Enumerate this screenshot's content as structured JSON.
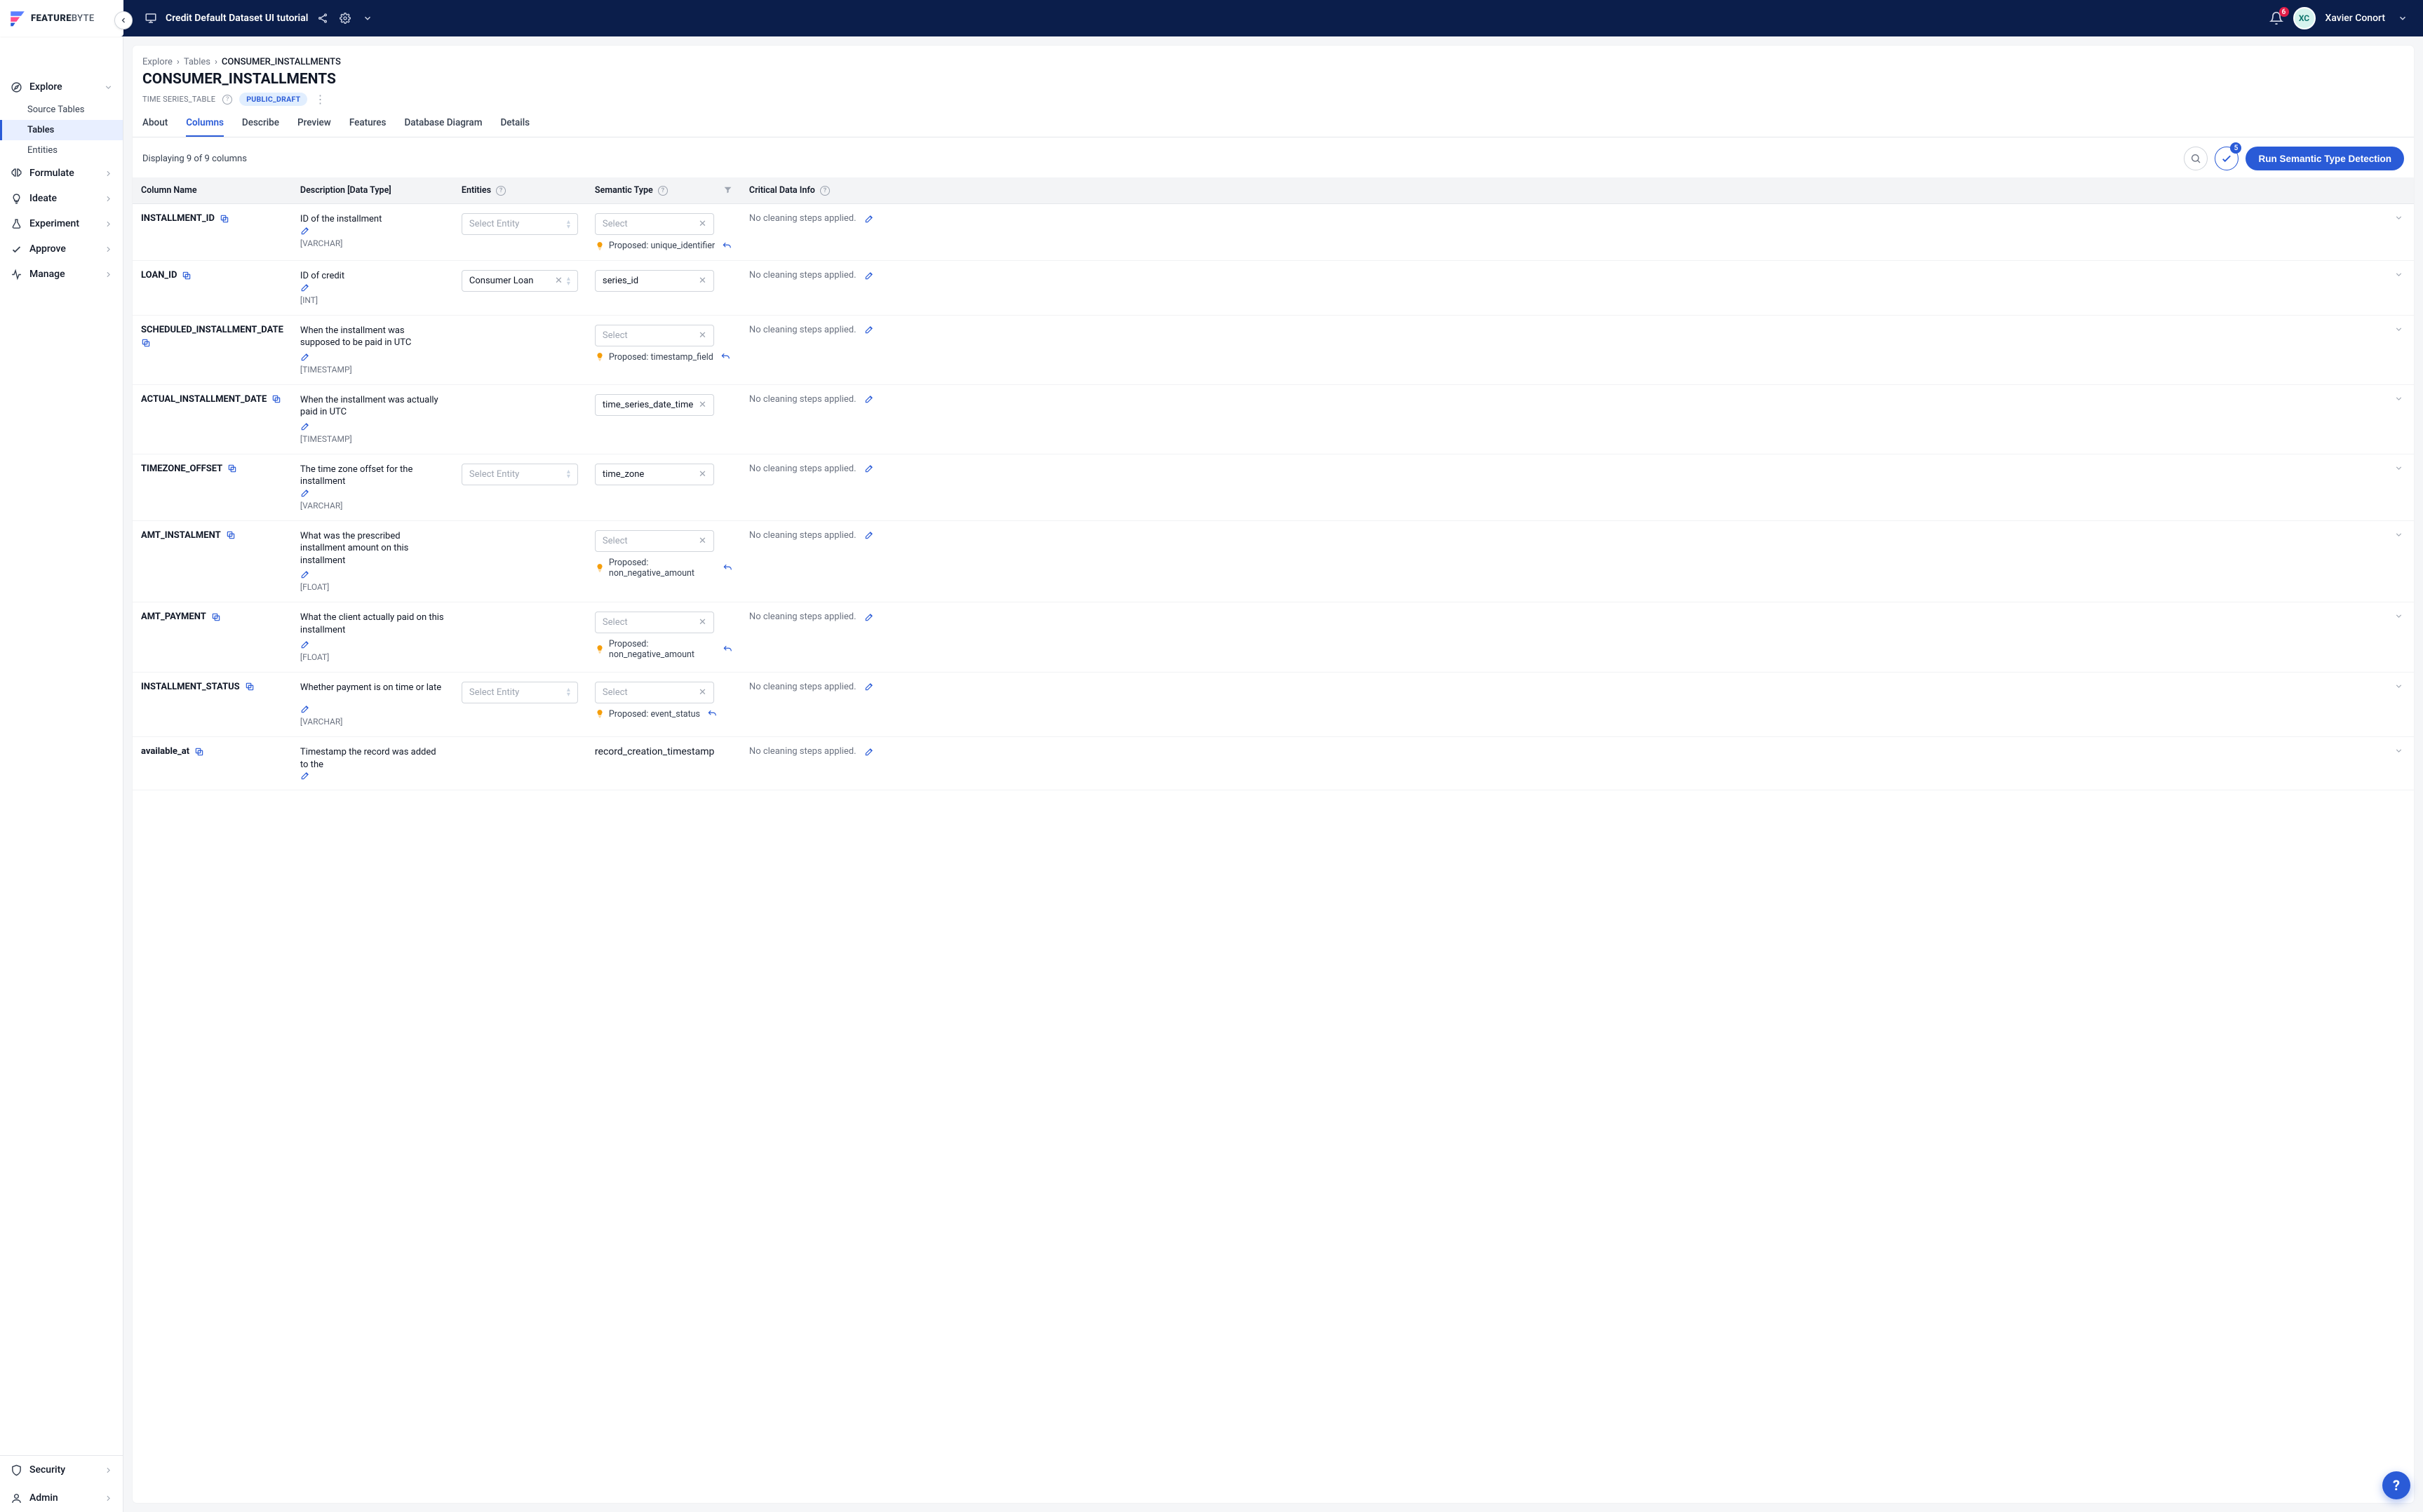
{
  "brand": {
    "name1": "FEATURE",
    "name2": "BYTE"
  },
  "header": {
    "project": "Credit Default Dataset UI tutorial",
    "notification_count": "6",
    "user_initials": "XC",
    "user_name": "Xavier Conort"
  },
  "sidebar": {
    "top": [
      {
        "label": "Explore",
        "icon": "compass",
        "expanded": true
      },
      {
        "label": "Source Tables",
        "sub": true
      },
      {
        "label": "Tables",
        "sub": true,
        "active": true
      },
      {
        "label": "Entities",
        "sub": true
      },
      {
        "label": "Formulate",
        "icon": "brain"
      },
      {
        "label": "Ideate",
        "icon": "bulb"
      },
      {
        "label": "Experiment",
        "icon": "flask"
      },
      {
        "label": "Approve",
        "icon": "check"
      },
      {
        "label": "Manage",
        "icon": "activity"
      }
    ],
    "bottom": [
      {
        "label": "Security",
        "icon": "shield"
      },
      {
        "label": "Admin",
        "icon": "user"
      }
    ]
  },
  "breadcrumb": {
    "root": "Explore",
    "mid": "Tables",
    "current": "CONSUMER_INSTALLMENTS"
  },
  "page": {
    "title": "CONSUMER_INSTALLMENTS",
    "type_label": "TIME SERIES_TABLE",
    "status_pill": "PUBLIC_DRAFT"
  },
  "tabs": [
    {
      "label": "About"
    },
    {
      "label": "Columns",
      "active": true
    },
    {
      "label": "Describe"
    },
    {
      "label": "Preview"
    },
    {
      "label": "Features"
    },
    {
      "label": "Database Diagram"
    },
    {
      "label": "Details"
    }
  ],
  "toolbar": {
    "displaying": "Displaying 9 of 9 columns",
    "check_badge": "5",
    "run_label": "Run Semantic Type Detection"
  },
  "columns_header": {
    "name": "Column Name",
    "desc": "Description [Data Type]",
    "ent": "Entities",
    "sem": "Semantic Type",
    "cdi": "Critical Data Info"
  },
  "select_ph": "Select",
  "select_entity_ph": "Select Entity",
  "proposed_prefix": "Proposed:",
  "rows": [
    {
      "name": "INSTALLMENT_ID",
      "desc": "ID of the installment",
      "dtype": "[VARCHAR]",
      "entity": {
        "show": true
      },
      "semantic": {
        "proposed": "unique_identifier"
      },
      "cdi": "No cleaning steps applied."
    },
    {
      "name": "LOAN_ID",
      "desc": "ID of credit",
      "dtype": "[INT]",
      "entity": {
        "show": true,
        "value": "Consumer Loan"
      },
      "semantic": {
        "value": "series_id"
      },
      "cdi": "No cleaning steps applied."
    },
    {
      "name": "SCHEDULED_INSTALLMENT_DATE",
      "desc": "When the installment was supposed to be paid in UTC",
      "dtype": "[TIMESTAMP]",
      "entity": {
        "show": false
      },
      "semantic": {
        "proposed": "timestamp_field"
      },
      "cdi": "No cleaning steps applied."
    },
    {
      "name": "ACTUAL_INSTALLMENT_DATE",
      "desc": "When the installment was actually paid in UTC",
      "dtype": "[TIMESTAMP]",
      "entity": {
        "show": false
      },
      "semantic": {
        "value": "time_series_date_time"
      },
      "cdi": "No cleaning steps applied."
    },
    {
      "name": "TIMEZONE_OFFSET",
      "desc": "The time zone offset for the installment",
      "dtype": "[VARCHAR]",
      "entity": {
        "show": true
      },
      "semantic": {
        "value": "time_zone"
      },
      "cdi": "No cleaning steps applied."
    },
    {
      "name": "AMT_INSTALMENT",
      "desc": "What was the prescribed installment amount on this installment",
      "dtype": "[FLOAT]",
      "entity": {
        "show": false
      },
      "semantic": {
        "proposed": "non_negative_amount"
      },
      "cdi": "No cleaning steps applied."
    },
    {
      "name": "AMT_PAYMENT",
      "desc": "What the client actually paid on this installment",
      "dtype": "[FLOAT]",
      "entity": {
        "show": false
      },
      "semantic": {
        "proposed": "non_negative_amount"
      },
      "cdi": "No cleaning steps applied."
    },
    {
      "name": "INSTALLMENT_STATUS",
      "desc": "Whether payment is on time or late",
      "dtype": "[VARCHAR]",
      "entity": {
        "show": true
      },
      "semantic": {
        "proposed": "event_status"
      },
      "cdi": "No cleaning steps applied."
    },
    {
      "name": "available_at",
      "desc": "Timestamp the record was added to the",
      "dtype": "",
      "entity": {
        "show": false
      },
      "semantic": {
        "value": "record_creation_timestamp",
        "bare": true
      },
      "cdi": "No cleaning steps applied.",
      "cutoff": true
    }
  ]
}
